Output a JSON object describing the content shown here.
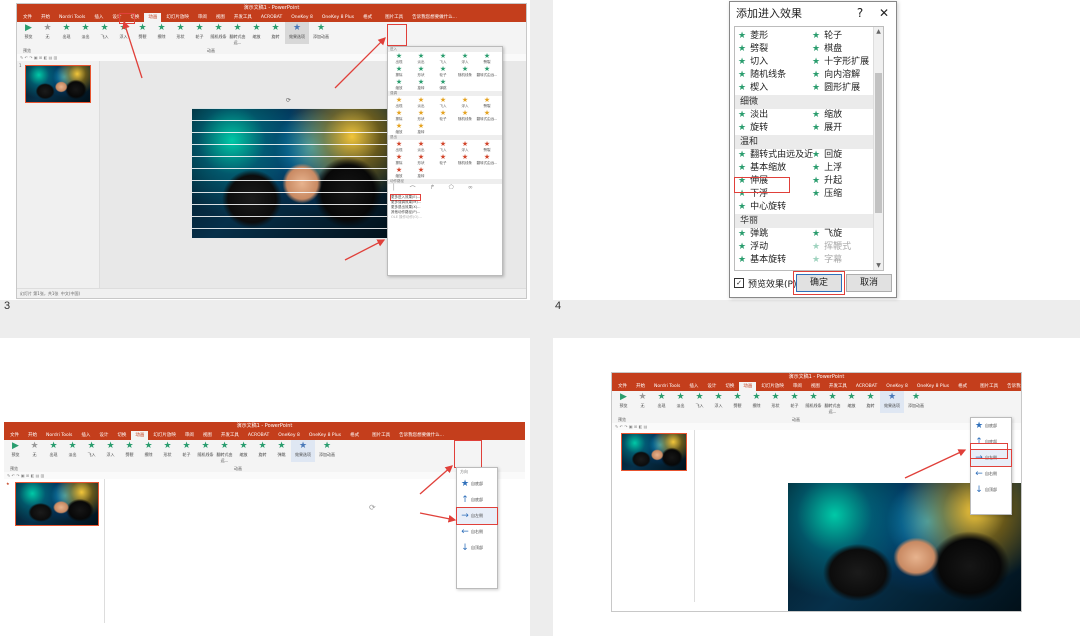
{
  "panel_numbers": [
    "3",
    "4"
  ],
  "ppt": {
    "title": "演示文稿1 - PowerPoint",
    "tools_title": "图片工具",
    "tabs": [
      "文件",
      "开始",
      "Nordri Tools",
      "插入",
      "设计",
      "切换",
      "动画",
      "幻灯片放映",
      "审阅",
      "视图",
      "开发工具",
      "ACROBAT",
      "OneKey 8",
      "OneKey 8 Plus",
      "格式"
    ],
    "active_tab": "动画",
    "tell_me": "告诉我您想要做什么...",
    "effects": [
      "预览",
      "无",
      "出现",
      "淡出",
      "飞入",
      "浮入",
      "劈裂",
      "擦除",
      "形状",
      "轮子",
      "随机线条",
      "翻转式由远...",
      "缩放",
      "旋转",
      "弹跳"
    ],
    "group_preview": "预览",
    "group_animation": "动画",
    "effect_options_label": "效果选项",
    "add_animation_label": "添加动画",
    "status_left": "幻灯片 第1张，共1张",
    "status_lang": "中文(中国)"
  },
  "gallery": {
    "sections": [
      "进入",
      "强调",
      "退出",
      "动作路径"
    ],
    "menu": [
      "更多进入效果(E)...",
      "更多强调效果(M)...",
      "更多退出效果(X)...",
      "其他动作路径(P)...",
      "OLE 操作动作(O)..."
    ]
  },
  "dialog": {
    "title": "添加进入效果",
    "help": "?",
    "close": "✕",
    "rows_top": [
      [
        "菱形",
        "轮子"
      ],
      [
        "劈裂",
        "棋盘"
      ],
      [
        "切入",
        "十字形扩展"
      ],
      [
        "随机线条",
        "向内溶解"
      ],
      [
        "楔入",
        "圆形扩展"
      ]
    ],
    "cat_subtle": "细微",
    "rows_subtle": [
      [
        "淡出",
        "缩放"
      ],
      [
        "旋转",
        "展开"
      ]
    ],
    "cat_moderate": "温和",
    "rows_moderate": [
      [
        "翻转式由远及近",
        "回旋"
      ],
      [
        "基本缩放",
        "上浮"
      ],
      [
        "伸展",
        "升起"
      ],
      [
        "下浮",
        "压缩"
      ],
      [
        "中心旋转",
        ""
      ]
    ],
    "cat_exciting": "华丽",
    "rows_exciting": [
      [
        "弹跳",
        "飞旋"
      ],
      [
        "浮动",
        "挥鞭式"
      ],
      [
        "基本旋转",
        "字幕"
      ]
    ],
    "preview_label": "预览效果(P)",
    "ok": "确定",
    "cancel": "取消"
  },
  "direction_menu": {
    "header": "方向",
    "items": [
      "自底部",
      "自左侧",
      "自右侧",
      "自顶部"
    ]
  },
  "colors": {
    "accent": "#c43e1c",
    "star": "#2a9d6e",
    "annotation": "#e0403a",
    "arrow_blue": "#2f6fba"
  }
}
